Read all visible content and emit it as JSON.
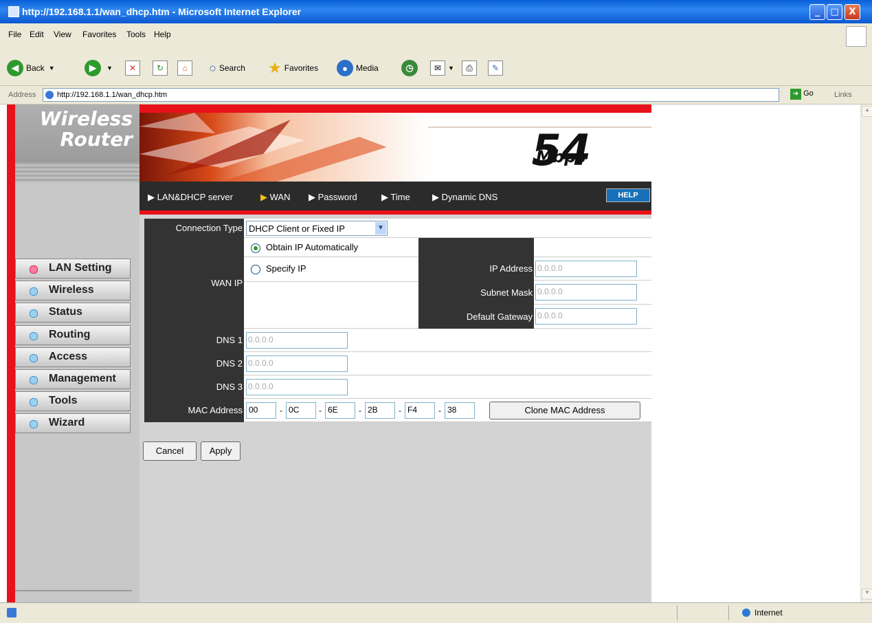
{
  "window": {
    "title": "http://192.168.1.1/wan_dhcp.htm - Microsoft Internet Explorer",
    "buttons": {
      "minimize": "_",
      "maximize": "□",
      "close": "X"
    }
  },
  "menu": [
    "File",
    "Edit",
    "View",
    "Favorites",
    "Tools",
    "Help"
  ],
  "toolbar": {
    "back": "Back",
    "search": "Search",
    "favorites": "Favorites",
    "media": "Media"
  },
  "address": {
    "label": "Address",
    "url": "http://192.168.1.1/wan_dhcp.htm",
    "go": "Go",
    "links": "Links"
  },
  "brand": {
    "line1": "Wireless",
    "line2": "Router"
  },
  "banner": {
    "speed": "54",
    "unit": "Mbps"
  },
  "topnav": {
    "items": [
      "LAN&DHCP server",
      "WAN",
      "Password",
      "Time",
      "Dynamic DNS"
    ],
    "help": "HELP"
  },
  "sidenav": {
    "items": [
      "LAN Setting",
      "Wireless",
      "Status",
      "Routing",
      "Access",
      "Management",
      "Tools",
      "Wizard"
    ],
    "active": "LAN Setting"
  },
  "form": {
    "connection_type_label": "Connection Type",
    "connection_type_value": "DHCP Client or Fixed IP",
    "wan_ip_label": "WAN IP",
    "obtain_auto": "Obtain IP Automatically",
    "specify_ip": "Specify IP",
    "ip_address_label": "IP Address",
    "ip_address_value": "0.0.0.0",
    "subnet_mask_label": "Subnet Mask",
    "subnet_mask_value": "0.0.0.0",
    "default_gateway_label": "Default Gateway",
    "default_gateway_value": "0.0.0.0",
    "dns1_label": "DNS 1",
    "dns1_value": "0.0.0.0",
    "dns2_label": "DNS 2",
    "dns2_value": "0.0.0.0",
    "dns3_label": "DNS 3",
    "dns3_value": "0.0.0.0",
    "mac_label": "MAC Address",
    "mac_octets": [
      "00",
      "0C",
      "6E",
      "2B",
      "F4",
      "38"
    ],
    "mac_sep": "-",
    "clone_mac": "Clone MAC Address",
    "cancel": "Cancel",
    "apply": "Apply"
  },
  "status": {
    "zone": "Internet"
  }
}
